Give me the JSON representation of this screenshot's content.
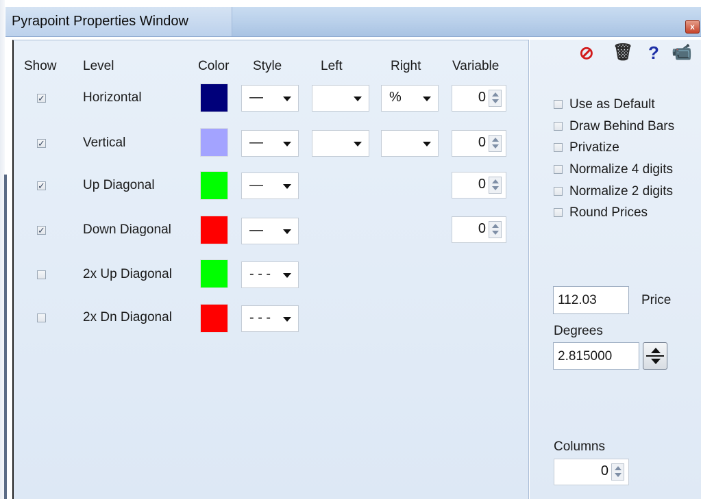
{
  "window": {
    "title": "Pyrapoint Properties Window",
    "close_glyph": "x"
  },
  "columns": {
    "show": "Show",
    "level": "Level",
    "color": "Color",
    "style": "Style",
    "left": "Left",
    "right": "Right",
    "variable": "Variable"
  },
  "rows": [
    {
      "checked": true,
      "check_glyph": "✓",
      "level": "Horizontal",
      "color": "#00007a",
      "style": "—",
      "left": "",
      "right": "%",
      "variable": "0"
    },
    {
      "checked": true,
      "check_glyph": "✓",
      "level": "Vertical",
      "color": "#a3a3ff",
      "style": "—",
      "left": "",
      "right": "",
      "variable": "0"
    },
    {
      "checked": true,
      "check_glyph": "✓",
      "level": "Up Diagonal",
      "color": "#00ff00",
      "style": "—",
      "variable": "0"
    },
    {
      "checked": true,
      "check_glyph": "✓",
      "level": "Down Diagonal",
      "color": "#ff0000",
      "style": "—",
      "variable": "0"
    },
    {
      "checked": false,
      "check_glyph": "",
      "level": "2x Up Diagonal",
      "color": "#00ff00",
      "style": "- - -"
    },
    {
      "checked": false,
      "check_glyph": "",
      "level": "2x Dn Diagonal",
      "color": "#ff0000",
      "style": "- - -"
    }
  ],
  "toolbar": {
    "cancel_icon": "no-entry-icon",
    "cancel_glyph": "⊘",
    "delete_icon": "trash-icon",
    "delete_glyph": "🗑",
    "help_icon": "question-icon",
    "help_glyph": "?",
    "camera_icon": "camera-icon",
    "camera_glyph": "📹"
  },
  "options": [
    {
      "label": "Use as Default",
      "checked": false
    },
    {
      "label": "Draw Behind Bars",
      "checked": false
    },
    {
      "label": "Privatize",
      "checked": false
    },
    {
      "label": "Normalize 4 digits",
      "checked": false
    },
    {
      "label": "Normalize 2 digits",
      "checked": false
    },
    {
      "label": "Round Prices",
      "checked": false
    }
  ],
  "price": {
    "value": "112.03",
    "label": "Price"
  },
  "degrees": {
    "label": "Degrees",
    "value": "2.815000"
  },
  "columns_setting": {
    "label": "Columns",
    "value": "0"
  },
  "colors": {
    "title_bar": "#b8cfea",
    "panel_bg": "#e3ecf7"
  }
}
